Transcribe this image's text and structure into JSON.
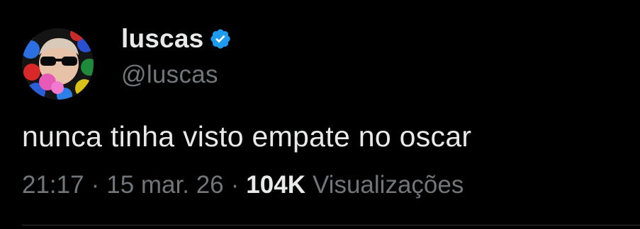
{
  "author": {
    "display_name": "luscas",
    "handle": "@luscas",
    "verified": true,
    "verified_color": "#1d9bf0"
  },
  "tweet": {
    "text": "nunca tinha visto empate no oscar"
  },
  "meta": {
    "time": "21:17",
    "separator_1": "·",
    "date": "15 mar. 26",
    "separator_2": "·",
    "views_count": "104K",
    "views_label": "Visualizações"
  },
  "colors": {
    "background": "#000000",
    "primary_text": "#e7e9ea",
    "secondary_text": "#71767b",
    "divider": "#2f3336"
  },
  "icons": {
    "verified": "verified-badge-icon",
    "avatar": "profile-avatar"
  }
}
